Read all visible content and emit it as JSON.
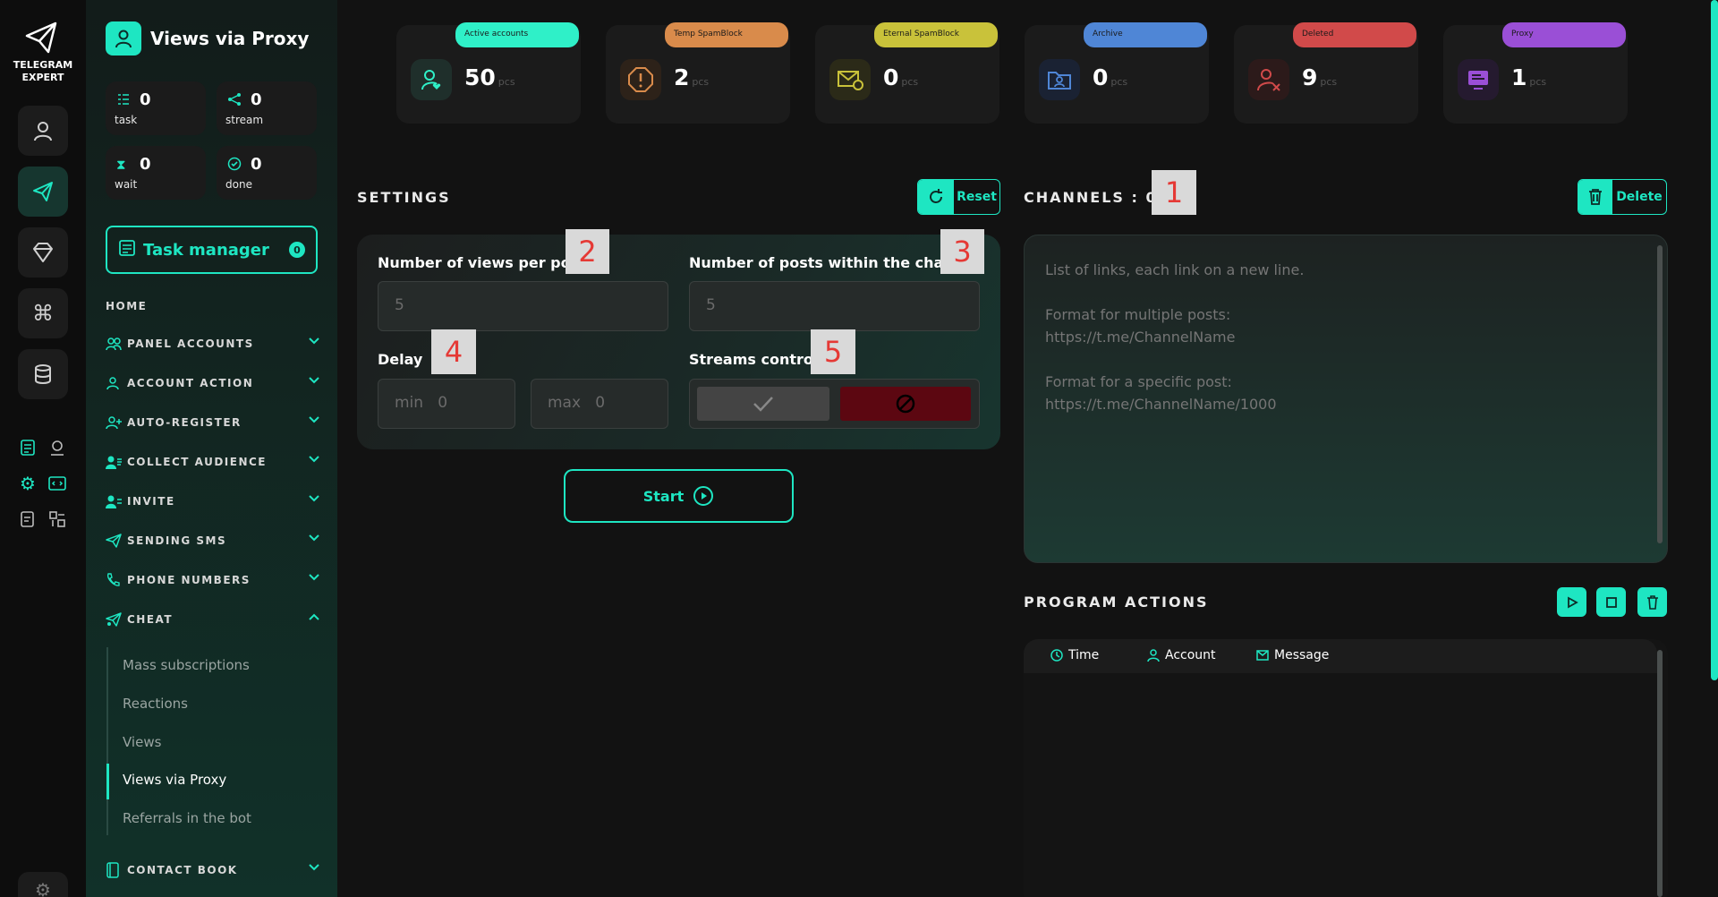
{
  "app": {
    "logo_line1": "TELEGRAM",
    "logo_line2": "EXPERT",
    "page_title": "Views via Proxy"
  },
  "colors": {
    "accent": "#1ee6c2",
    "active": "#2ff0c8",
    "temp": "#d98b4b",
    "eternal": "#c9c23a",
    "archive": "#4f86d6",
    "deleted": "#d14a4a",
    "proxy": "#9a4fd6"
  },
  "sidebar": {
    "stats": [
      {
        "value": "0",
        "label": "task",
        "icon": "task-list-icon"
      },
      {
        "value": "0",
        "label": "stream",
        "icon": "share-icon"
      },
      {
        "value": "0",
        "label": "wait",
        "icon": "hourglass-icon"
      },
      {
        "value": "0",
        "label": "done",
        "icon": "check-circle-icon"
      }
    ],
    "task_manager": {
      "label": "Task manager",
      "count": "0"
    },
    "home": "HOME",
    "nav": [
      {
        "label": "PANEL ACCOUNTS",
        "icon": "users-icon"
      },
      {
        "label": "ACCOUNT ACTION",
        "icon": "user-icon"
      },
      {
        "label": "AUTO-REGISTER",
        "icon": "user-plus-icon"
      },
      {
        "label": "COLLECT AUDIENCE",
        "icon": "audience-icon"
      },
      {
        "label": "INVITE",
        "icon": "invite-icon"
      },
      {
        "label": "SENDING SMS",
        "icon": "send-icon"
      },
      {
        "label": "PHONE NUMBERS",
        "icon": "phone-icon"
      },
      {
        "label": "CHEAT",
        "icon": "cheat-icon"
      }
    ],
    "cheat_items": [
      "Mass subscriptions",
      "Reactions",
      "Views",
      "Views via Proxy",
      "Referrals in the bot"
    ],
    "contact_book": "CONTACT BOOK"
  },
  "cards": [
    {
      "label": "Active accounts",
      "value": "50",
      "unit": "pcs",
      "icon": "user-heart-icon"
    },
    {
      "label": "Temp SpamBlock",
      "value": "2",
      "unit": "pcs",
      "icon": "alert-icon"
    },
    {
      "label": "Eternal SpamBlock",
      "value": "0",
      "unit": "pcs",
      "icon": "mail-block-icon"
    },
    {
      "label": "Archive",
      "value": "0",
      "unit": "pcs",
      "icon": "folder-user-icon"
    },
    {
      "label": "Deleted",
      "value": "9",
      "unit": "pcs",
      "icon": "user-x-icon"
    },
    {
      "label": "Proxy",
      "value": "1",
      "unit": "pcs",
      "icon": "proxy-icon"
    }
  ],
  "settings": {
    "title": "SETTINGS",
    "reset": "Reset",
    "views_label": "Number of views per post",
    "views_placeholder": "5",
    "posts_label": "Number of posts within the channel",
    "posts_placeholder": "5",
    "delay_label": "Delay",
    "min_prefix": "min",
    "min_placeholder": "0",
    "max_prefix": "max",
    "max_placeholder": "0",
    "streams_label": "Streams control",
    "start": "Start",
    "badges": [
      "2",
      "3",
      "4",
      "5"
    ]
  },
  "channels": {
    "title": "CHANNELS : 0",
    "badge": "1",
    "delete": "Delete",
    "placeholder": "List of links, each link on a new line.\n\nFormat for multiple posts:\nhttps://t.me/ChannelName\n\nFormat for a specific post:\nhttps://t.me/ChannelName/1000"
  },
  "program_actions": {
    "title": "PROGRAM ACTIONS",
    "columns": [
      {
        "label": "Time",
        "icon": "clock-icon"
      },
      {
        "label": "Account",
        "icon": "user-icon"
      },
      {
        "label": "Message",
        "icon": "mail-icon"
      }
    ]
  }
}
